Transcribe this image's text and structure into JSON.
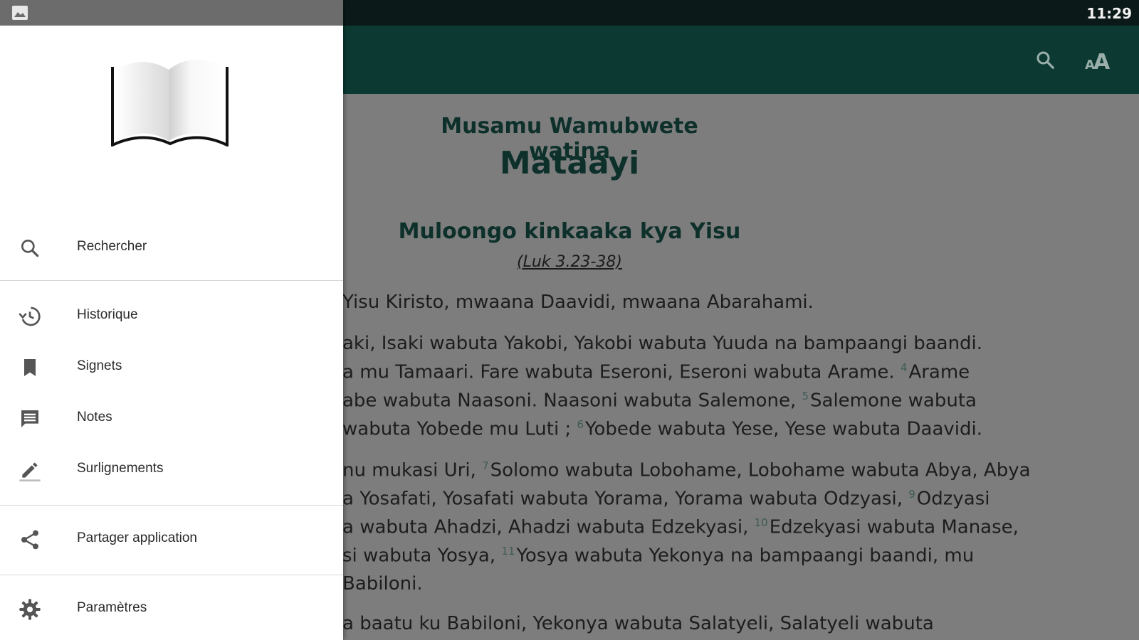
{
  "status_bar": {
    "time": "11:29"
  },
  "app_bar": {
    "search_icon": "search-icon",
    "font_size_icon": "font-size-icon",
    "font_size_label": "AA"
  },
  "drawer": {
    "logo_icon": "open-book-icon",
    "menu": [
      {
        "label": "Rechercher",
        "icon": "search-icon"
      },
      {
        "label": "Historique",
        "icon": "history-icon"
      },
      {
        "label": "Signets",
        "icon": "bookmark-icon"
      },
      {
        "label": "Notes",
        "icon": "notes-icon"
      },
      {
        "label": "Surlignements",
        "icon": "highlighter-icon"
      },
      {
        "label": "Partager application",
        "icon": "share-icon"
      },
      {
        "label": "Paramètres",
        "icon": "settings-icon"
      }
    ]
  },
  "reader": {
    "book_subtitle": "Musamu Wamubwete watina",
    "book_title": "Mataayi",
    "section_heading": "Muloongo kinkaaka kya Yisu",
    "section_reference": "(Luk 3.23-38)",
    "lines": [
      {
        "text": "Yisu Kiristo, mwaana Daavidi, mwaana Abarahami."
      },
      {
        "text": "aki, Isaki wabuta Yakobi, Yakobi wabuta Yuuda na bampaangi baandi."
      },
      {
        "text": "a mu Tamaari. Fare wabuta Eseroni, Eseroni wabuta Arame. ",
        "vnum": "4",
        "after": "Arame"
      },
      {
        "text": "abe wabuta Naasoni. Naasoni wabuta Salemone, ",
        "vnum": "5",
        "after": "Salemone wabuta"
      },
      {
        "text": "wabuta Yobede mu Luti ; ",
        "vnum": "6",
        "after": "Yobede wabuta Yese, Yese wabuta Daavidi."
      },
      {
        "text": "nu mukasi Uri, ",
        "vnum": "7",
        "after": "Solomo wabuta Lobohame, Lobohame wabuta Abya, Abya"
      },
      {
        "text": "a Yosafati, Yosafati wabuta Yorama, Yorama wabuta Odzyasi, ",
        "vnum": "9",
        "after": "Odzyasi"
      },
      {
        "text": "a wabuta Ahadzi, Ahadzi wabuta Edzekyasi, ",
        "vnum": "10",
        "after": "Edzekyasi wabuta Manase,"
      },
      {
        "text": "si wabuta Yosya, ",
        "vnum": "11",
        "after": "Yosya wabuta Yekonya na bampaangi baandi, mu"
      },
      {
        "text": "Babiloni."
      },
      {
        "text": "a baatu ku Babiloni, Yekonya wabuta Salatyeli, Salatyeli wabuta"
      }
    ]
  }
}
